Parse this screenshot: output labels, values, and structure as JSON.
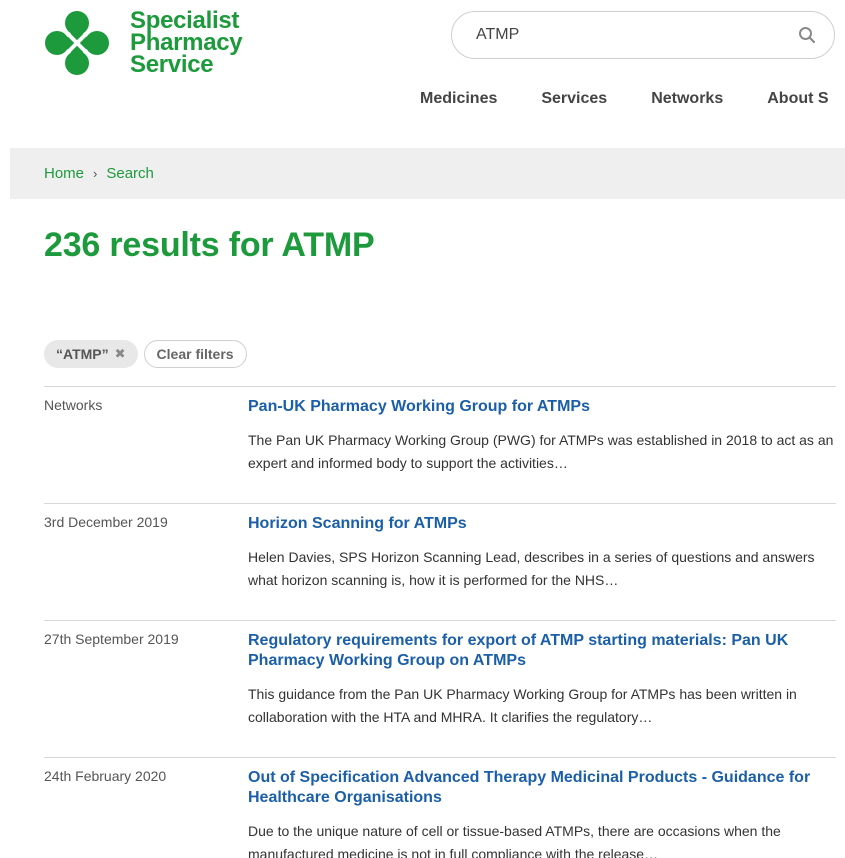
{
  "brand": {
    "line1": "Specialist",
    "line2": "Pharmacy",
    "line3": "Service",
    "color": "#1d9a3c",
    "logo_icon": "logo-clover-icon"
  },
  "search": {
    "value": "ATMP",
    "icon": "search-icon"
  },
  "nav": {
    "items": [
      "Medicines",
      "Services",
      "Networks",
      "About S"
    ]
  },
  "breadcrumb": {
    "home": "Home",
    "separator": "›",
    "current": "Search"
  },
  "results_heading": "236 results for ATMP",
  "filters": {
    "active": "“ATMP”",
    "remove_icon": "✖",
    "clear": "Clear filters"
  },
  "results": [
    {
      "meta": "Networks",
      "title": "Pan-UK Pharmacy Working Group for ATMPs",
      "desc": "The Pan UK Pharmacy Working Group (PWG) for ATMPs was established in 2018 to act as an expert and informed body to support the activities…"
    },
    {
      "meta": "3rd December 2019",
      "title": "Horizon Scanning for ATMPs",
      "desc": "Helen Davies, SPS Horizon Scanning Lead, describes in a series of questions and answers what horizon scanning is, how it is performed for the NHS…"
    },
    {
      "meta": "27th September 2019",
      "title": "Regulatory requirements for export of ATMP starting materials: Pan UK Pharmacy Working Group on ATMPs",
      "desc": "This guidance from the Pan UK Pharmacy Working Group for ATMPs has been written in collaboration with the HTA and MHRA. It clarifies the regulatory…"
    },
    {
      "meta": "24th February 2020",
      "title": "Out of Specification Advanced Therapy Medicinal Products - Guidance for Healthcare Organisations",
      "desc": "Due to the unique nature of cell or tissue-based ATMPs, there are occasions  when the manufactured medicine is not in full compliance with the release…"
    }
  ]
}
